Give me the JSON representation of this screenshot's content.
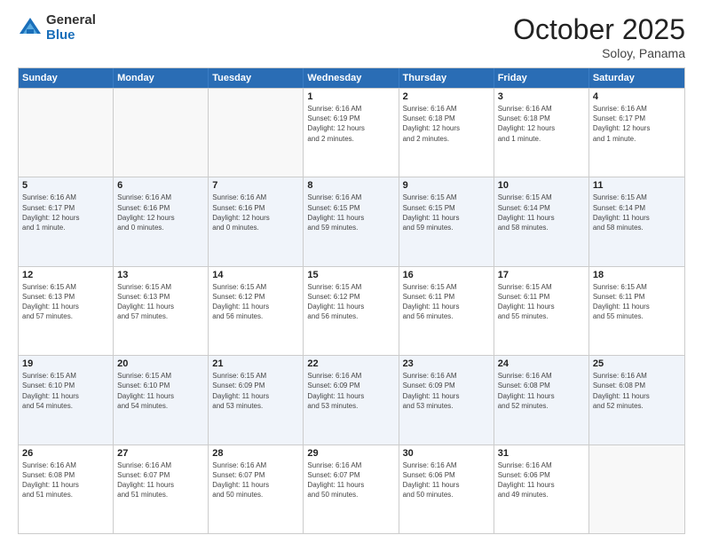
{
  "header": {
    "logo_general": "General",
    "logo_blue": "Blue",
    "month_title": "October 2025",
    "subtitle": "Soloy, Panama"
  },
  "weekdays": [
    "Sunday",
    "Monday",
    "Tuesday",
    "Wednesday",
    "Thursday",
    "Friday",
    "Saturday"
  ],
  "rows": [
    [
      {
        "day": "",
        "lines": []
      },
      {
        "day": "",
        "lines": []
      },
      {
        "day": "",
        "lines": []
      },
      {
        "day": "1",
        "lines": [
          "Sunrise: 6:16 AM",
          "Sunset: 6:19 PM",
          "Daylight: 12 hours",
          "and 2 minutes."
        ]
      },
      {
        "day": "2",
        "lines": [
          "Sunrise: 6:16 AM",
          "Sunset: 6:18 PM",
          "Daylight: 12 hours",
          "and 2 minutes."
        ]
      },
      {
        "day": "3",
        "lines": [
          "Sunrise: 6:16 AM",
          "Sunset: 6:18 PM",
          "Daylight: 12 hours",
          "and 1 minute."
        ]
      },
      {
        "day": "4",
        "lines": [
          "Sunrise: 6:16 AM",
          "Sunset: 6:17 PM",
          "Daylight: 12 hours",
          "and 1 minute."
        ]
      }
    ],
    [
      {
        "day": "5",
        "lines": [
          "Sunrise: 6:16 AM",
          "Sunset: 6:17 PM",
          "Daylight: 12 hours",
          "and 1 minute."
        ]
      },
      {
        "day": "6",
        "lines": [
          "Sunrise: 6:16 AM",
          "Sunset: 6:16 PM",
          "Daylight: 12 hours",
          "and 0 minutes."
        ]
      },
      {
        "day": "7",
        "lines": [
          "Sunrise: 6:16 AM",
          "Sunset: 6:16 PM",
          "Daylight: 12 hours",
          "and 0 minutes."
        ]
      },
      {
        "day": "8",
        "lines": [
          "Sunrise: 6:16 AM",
          "Sunset: 6:15 PM",
          "Daylight: 11 hours",
          "and 59 minutes."
        ]
      },
      {
        "day": "9",
        "lines": [
          "Sunrise: 6:15 AM",
          "Sunset: 6:15 PM",
          "Daylight: 11 hours",
          "and 59 minutes."
        ]
      },
      {
        "day": "10",
        "lines": [
          "Sunrise: 6:15 AM",
          "Sunset: 6:14 PM",
          "Daylight: 11 hours",
          "and 58 minutes."
        ]
      },
      {
        "day": "11",
        "lines": [
          "Sunrise: 6:15 AM",
          "Sunset: 6:14 PM",
          "Daylight: 11 hours",
          "and 58 minutes."
        ]
      }
    ],
    [
      {
        "day": "12",
        "lines": [
          "Sunrise: 6:15 AM",
          "Sunset: 6:13 PM",
          "Daylight: 11 hours",
          "and 57 minutes."
        ]
      },
      {
        "day": "13",
        "lines": [
          "Sunrise: 6:15 AM",
          "Sunset: 6:13 PM",
          "Daylight: 11 hours",
          "and 57 minutes."
        ]
      },
      {
        "day": "14",
        "lines": [
          "Sunrise: 6:15 AM",
          "Sunset: 6:12 PM",
          "Daylight: 11 hours",
          "and 56 minutes."
        ]
      },
      {
        "day": "15",
        "lines": [
          "Sunrise: 6:15 AM",
          "Sunset: 6:12 PM",
          "Daylight: 11 hours",
          "and 56 minutes."
        ]
      },
      {
        "day": "16",
        "lines": [
          "Sunrise: 6:15 AM",
          "Sunset: 6:11 PM",
          "Daylight: 11 hours",
          "and 56 minutes."
        ]
      },
      {
        "day": "17",
        "lines": [
          "Sunrise: 6:15 AM",
          "Sunset: 6:11 PM",
          "Daylight: 11 hours",
          "and 55 minutes."
        ]
      },
      {
        "day": "18",
        "lines": [
          "Sunrise: 6:15 AM",
          "Sunset: 6:11 PM",
          "Daylight: 11 hours",
          "and 55 minutes."
        ]
      }
    ],
    [
      {
        "day": "19",
        "lines": [
          "Sunrise: 6:15 AM",
          "Sunset: 6:10 PM",
          "Daylight: 11 hours",
          "and 54 minutes."
        ]
      },
      {
        "day": "20",
        "lines": [
          "Sunrise: 6:15 AM",
          "Sunset: 6:10 PM",
          "Daylight: 11 hours",
          "and 54 minutes."
        ]
      },
      {
        "day": "21",
        "lines": [
          "Sunrise: 6:15 AM",
          "Sunset: 6:09 PM",
          "Daylight: 11 hours",
          "and 53 minutes."
        ]
      },
      {
        "day": "22",
        "lines": [
          "Sunrise: 6:16 AM",
          "Sunset: 6:09 PM",
          "Daylight: 11 hours",
          "and 53 minutes."
        ]
      },
      {
        "day": "23",
        "lines": [
          "Sunrise: 6:16 AM",
          "Sunset: 6:09 PM",
          "Daylight: 11 hours",
          "and 53 minutes."
        ]
      },
      {
        "day": "24",
        "lines": [
          "Sunrise: 6:16 AM",
          "Sunset: 6:08 PM",
          "Daylight: 11 hours",
          "and 52 minutes."
        ]
      },
      {
        "day": "25",
        "lines": [
          "Sunrise: 6:16 AM",
          "Sunset: 6:08 PM",
          "Daylight: 11 hours",
          "and 52 minutes."
        ]
      }
    ],
    [
      {
        "day": "26",
        "lines": [
          "Sunrise: 6:16 AM",
          "Sunset: 6:08 PM",
          "Daylight: 11 hours",
          "and 51 minutes."
        ]
      },
      {
        "day": "27",
        "lines": [
          "Sunrise: 6:16 AM",
          "Sunset: 6:07 PM",
          "Daylight: 11 hours",
          "and 51 minutes."
        ]
      },
      {
        "day": "28",
        "lines": [
          "Sunrise: 6:16 AM",
          "Sunset: 6:07 PM",
          "Daylight: 11 hours",
          "and 50 minutes."
        ]
      },
      {
        "day": "29",
        "lines": [
          "Sunrise: 6:16 AM",
          "Sunset: 6:07 PM",
          "Daylight: 11 hours",
          "and 50 minutes."
        ]
      },
      {
        "day": "30",
        "lines": [
          "Sunrise: 6:16 AM",
          "Sunset: 6:06 PM",
          "Daylight: 11 hours",
          "and 50 minutes."
        ]
      },
      {
        "day": "31",
        "lines": [
          "Sunrise: 6:16 AM",
          "Sunset: 6:06 PM",
          "Daylight: 11 hours",
          "and 49 minutes."
        ]
      },
      {
        "day": "",
        "lines": []
      }
    ]
  ]
}
